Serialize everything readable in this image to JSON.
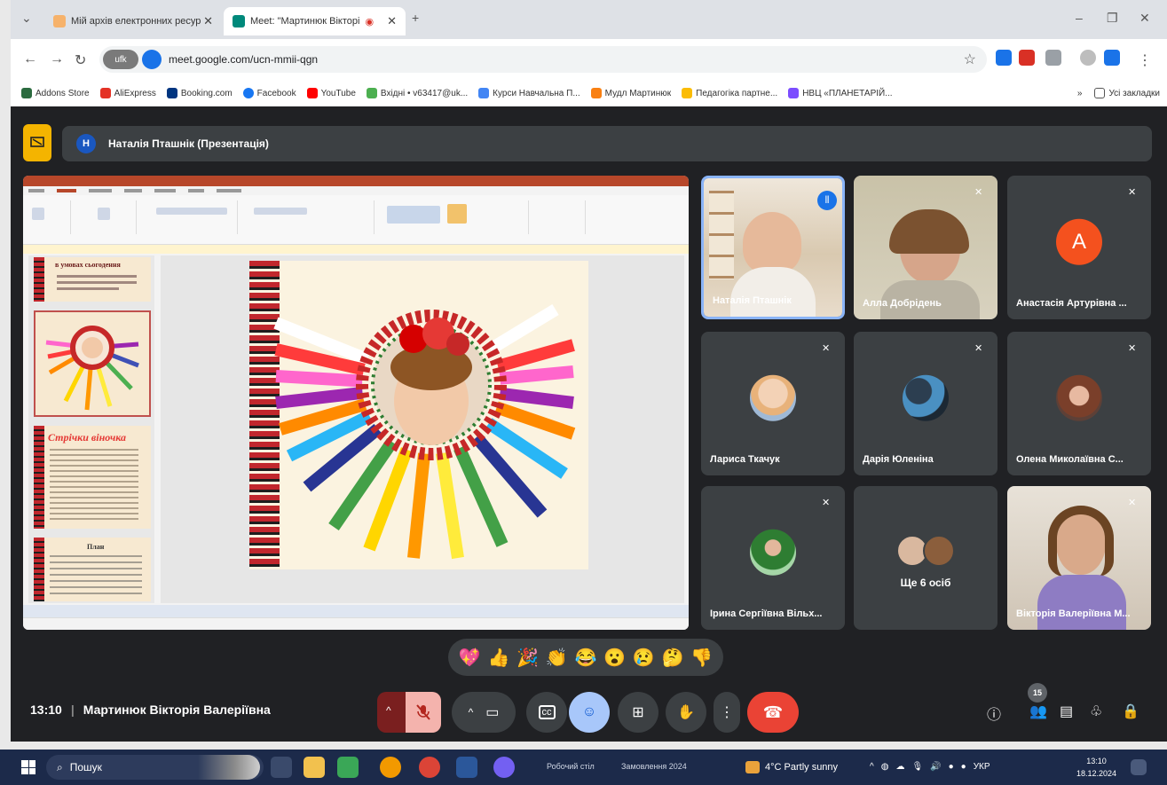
{
  "browser": {
    "tabs": [
      {
        "title": "Мій архів електронних ресур",
        "active": false
      },
      {
        "title": "Meet: \"Мартинюк Вікторі",
        "active": true
      }
    ],
    "url": "meet.google.com/ucn-mmii-qgn",
    "tune_label": "ufk",
    "bookmarks": [
      {
        "label": "Addons Store",
        "color": "#2b6b3f"
      },
      {
        "label": "AliExpress",
        "color": "#e43225"
      },
      {
        "label": "Booking.com",
        "color": "#003580"
      },
      {
        "label": "Facebook",
        "color": "#1877f2"
      },
      {
        "label": "YouTube",
        "color": "#ff0000"
      },
      {
        "label": "Вхідні • v63417@uk...",
        "color": "#4caf50"
      },
      {
        "label": "Курси Навчальна П...",
        "color": "#4285f4"
      },
      {
        "label": "Мудл Мартинюк",
        "color": "#f98012"
      },
      {
        "label": "Педагогіка партне...",
        "color": "#fbbc04"
      },
      {
        "label": "НВЦ «ПЛАНЕТАРІЙ...",
        "color": "#7c4dff"
      }
    ],
    "all_bookmarks": "Усі закладки"
  },
  "meet": {
    "presenter": {
      "initial": "Н",
      "label": "Наталія Пташнік (Презентація)"
    },
    "participants": [
      {
        "name": "Наталія Пташнік",
        "muted": false,
        "active": true,
        "kind": "video",
        "color": "#d9c9b0"
      },
      {
        "name": "Алла Добрідень",
        "muted": true,
        "active": false,
        "kind": "video",
        "color": "#c9c2a8"
      },
      {
        "name": "Анастасія Артурівна ...",
        "muted": true,
        "active": false,
        "kind": "letter",
        "initial": "A",
        "color": "#f4511e"
      },
      {
        "name": "Лариса Ткачук",
        "muted": true,
        "active": false,
        "kind": "photo",
        "color": "#d7b9a0"
      },
      {
        "name": "Дарія Юленіна",
        "muted": true,
        "active": false,
        "kind": "photo",
        "color": "#34495e"
      },
      {
        "name": "Олена Миколаївна С...",
        "muted": true,
        "active": false,
        "kind": "photo",
        "color": "#8d5a44"
      },
      {
        "name": "Ірина Сергіївна Вільх...",
        "muted": true,
        "active": false,
        "kind": "photo",
        "color": "#3f8f5c"
      },
      {
        "name": "Ще 6 осіб",
        "muted": false,
        "active": false,
        "kind": "more",
        "color": "#c7a98f"
      },
      {
        "name": "Вікторія Валеріївна М...",
        "muted": true,
        "active": false,
        "kind": "video",
        "color": "#c9b8a6"
      }
    ],
    "reactions": [
      "💖",
      "👍",
      "🎉",
      "👏",
      "😂",
      "😮",
      "😢",
      "🤔",
      "👎"
    ],
    "time": "13:10",
    "meeting_title": "Мартинюк Вікторія Валеріївна",
    "people_count": "15"
  },
  "slides": {
    "thumb1_title": "в умовах сьогодення",
    "thumb3_title": "Стрічки віночка",
    "thumb4_title": "План"
  },
  "taskbar": {
    "search_placeholder": "Пошук",
    "desktop_label": "Робочий стіл",
    "orders_label": "Замовлення 2024",
    "weather": "4°C Partly sunny",
    "lang": "УКР",
    "clock_time": "13:10",
    "clock_date": "18.12.2024"
  },
  "colors": {
    "meet_bg": "#202124",
    "tile_bg": "#3c4043",
    "end_call": "#ea4335",
    "active_border": "#8ab4f8"
  }
}
